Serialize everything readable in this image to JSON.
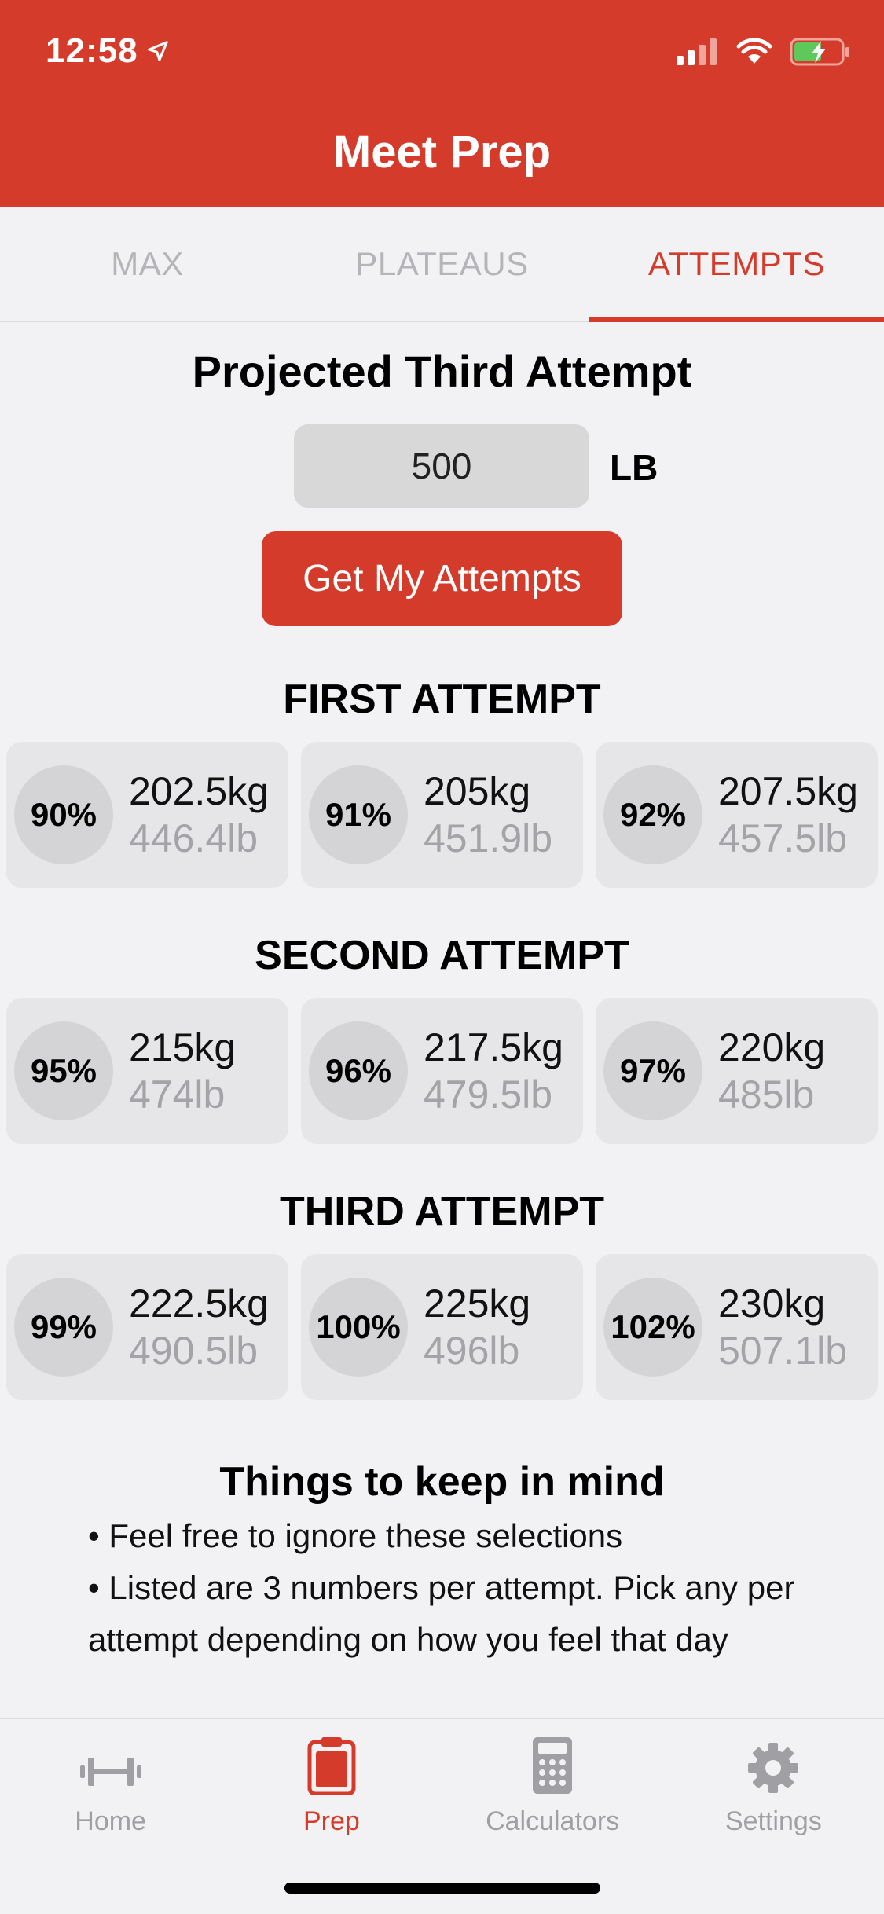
{
  "status_bar": {
    "time": "12:58"
  },
  "header": {
    "title": "Meet Prep"
  },
  "tabs": [
    {
      "label": "MAX",
      "active": false
    },
    {
      "label": "PLATEAUS",
      "active": false
    },
    {
      "label": "ATTEMPTS",
      "active": true
    }
  ],
  "projected": {
    "title": "Projected Third Attempt",
    "value": "500",
    "unit": "LB",
    "button_label": "Get My Attempts"
  },
  "attempts": [
    {
      "title": "FIRST ATTEMPT",
      "options": [
        {
          "pct": "90%",
          "kg": "202.5kg",
          "lb": "446.4lb"
        },
        {
          "pct": "91%",
          "kg": "205kg",
          "lb": "451.9lb"
        },
        {
          "pct": "92%",
          "kg": "207.5kg",
          "lb": "457.5lb"
        }
      ]
    },
    {
      "title": "SECOND ATTEMPT",
      "options": [
        {
          "pct": "95%",
          "kg": "215kg",
          "lb": "474lb"
        },
        {
          "pct": "96%",
          "kg": "217.5kg",
          "lb": "479.5lb"
        },
        {
          "pct": "97%",
          "kg": "220kg",
          "lb": "485lb"
        }
      ]
    },
    {
      "title": "THIRD ATTEMPT",
      "options": [
        {
          "pct": "99%",
          "kg": "222.5kg",
          "lb": "490.5lb"
        },
        {
          "pct": "100%",
          "kg": "225kg",
          "lb": "496lb"
        },
        {
          "pct": "102%",
          "kg": "230kg",
          "lb": "507.1lb"
        }
      ]
    }
  ],
  "notes": {
    "title": "Things to keep in mind",
    "items": [
      "• Feel free to ignore these selections",
      "• Listed are 3 numbers per attempt. Pick any per attempt depending on how you feel that day"
    ]
  },
  "tabbar": {
    "items": [
      {
        "label": "Home",
        "icon": "barbell-icon",
        "active": false
      },
      {
        "label": "Prep",
        "icon": "clipboard-icon",
        "active": true
      },
      {
        "label": "Calculators",
        "icon": "calculator-icon",
        "active": false
      },
      {
        "label": "Settings",
        "icon": "gear-icon",
        "active": false
      }
    ]
  },
  "colors": {
    "accent": "#d53b2b",
    "background": "#f2f2f4",
    "card": "#e6e6e8"
  }
}
